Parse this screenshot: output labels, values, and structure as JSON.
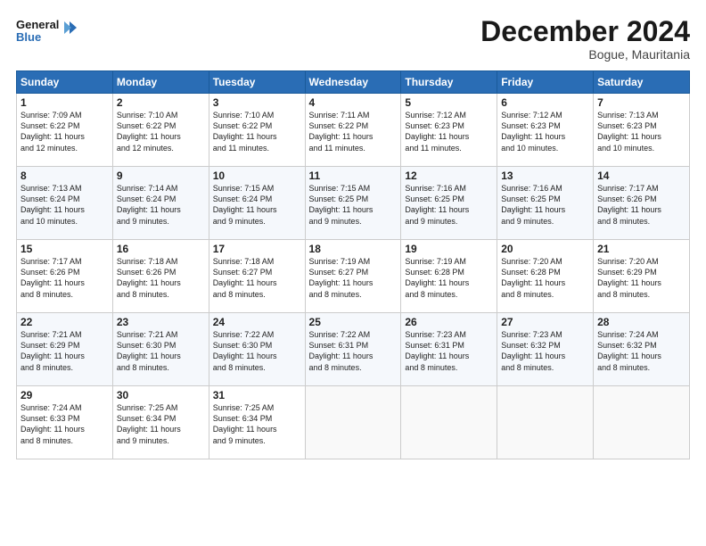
{
  "logo": {
    "line1": "General",
    "line2": "Blue"
  },
  "title": "December 2024",
  "subtitle": "Bogue, Mauritania",
  "days": [
    "Sunday",
    "Monday",
    "Tuesday",
    "Wednesday",
    "Thursday",
    "Friday",
    "Saturday"
  ],
  "weeks": [
    [
      {
        "day": "1",
        "info": "Sunrise: 7:09 AM\nSunset: 6:22 PM\nDaylight: 11 hours\nand 12 minutes."
      },
      {
        "day": "2",
        "info": "Sunrise: 7:10 AM\nSunset: 6:22 PM\nDaylight: 11 hours\nand 12 minutes."
      },
      {
        "day": "3",
        "info": "Sunrise: 7:10 AM\nSunset: 6:22 PM\nDaylight: 11 hours\nand 11 minutes."
      },
      {
        "day": "4",
        "info": "Sunrise: 7:11 AM\nSunset: 6:22 PM\nDaylight: 11 hours\nand 11 minutes."
      },
      {
        "day": "5",
        "info": "Sunrise: 7:12 AM\nSunset: 6:23 PM\nDaylight: 11 hours\nand 11 minutes."
      },
      {
        "day": "6",
        "info": "Sunrise: 7:12 AM\nSunset: 6:23 PM\nDaylight: 11 hours\nand 10 minutes."
      },
      {
        "day": "7",
        "info": "Sunrise: 7:13 AM\nSunset: 6:23 PM\nDaylight: 11 hours\nand 10 minutes."
      }
    ],
    [
      {
        "day": "8",
        "info": "Sunrise: 7:13 AM\nSunset: 6:24 PM\nDaylight: 11 hours\nand 10 minutes."
      },
      {
        "day": "9",
        "info": "Sunrise: 7:14 AM\nSunset: 6:24 PM\nDaylight: 11 hours\nand 9 minutes."
      },
      {
        "day": "10",
        "info": "Sunrise: 7:15 AM\nSunset: 6:24 PM\nDaylight: 11 hours\nand 9 minutes."
      },
      {
        "day": "11",
        "info": "Sunrise: 7:15 AM\nSunset: 6:25 PM\nDaylight: 11 hours\nand 9 minutes."
      },
      {
        "day": "12",
        "info": "Sunrise: 7:16 AM\nSunset: 6:25 PM\nDaylight: 11 hours\nand 9 minutes."
      },
      {
        "day": "13",
        "info": "Sunrise: 7:16 AM\nSunset: 6:25 PM\nDaylight: 11 hours\nand 9 minutes."
      },
      {
        "day": "14",
        "info": "Sunrise: 7:17 AM\nSunset: 6:26 PM\nDaylight: 11 hours\nand 8 minutes."
      }
    ],
    [
      {
        "day": "15",
        "info": "Sunrise: 7:17 AM\nSunset: 6:26 PM\nDaylight: 11 hours\nand 8 minutes."
      },
      {
        "day": "16",
        "info": "Sunrise: 7:18 AM\nSunset: 6:26 PM\nDaylight: 11 hours\nand 8 minutes."
      },
      {
        "day": "17",
        "info": "Sunrise: 7:18 AM\nSunset: 6:27 PM\nDaylight: 11 hours\nand 8 minutes."
      },
      {
        "day": "18",
        "info": "Sunrise: 7:19 AM\nSunset: 6:27 PM\nDaylight: 11 hours\nand 8 minutes."
      },
      {
        "day": "19",
        "info": "Sunrise: 7:19 AM\nSunset: 6:28 PM\nDaylight: 11 hours\nand 8 minutes."
      },
      {
        "day": "20",
        "info": "Sunrise: 7:20 AM\nSunset: 6:28 PM\nDaylight: 11 hours\nand 8 minutes."
      },
      {
        "day": "21",
        "info": "Sunrise: 7:20 AM\nSunset: 6:29 PM\nDaylight: 11 hours\nand 8 minutes."
      }
    ],
    [
      {
        "day": "22",
        "info": "Sunrise: 7:21 AM\nSunset: 6:29 PM\nDaylight: 11 hours\nand 8 minutes."
      },
      {
        "day": "23",
        "info": "Sunrise: 7:21 AM\nSunset: 6:30 PM\nDaylight: 11 hours\nand 8 minutes."
      },
      {
        "day": "24",
        "info": "Sunrise: 7:22 AM\nSunset: 6:30 PM\nDaylight: 11 hours\nand 8 minutes."
      },
      {
        "day": "25",
        "info": "Sunrise: 7:22 AM\nSunset: 6:31 PM\nDaylight: 11 hours\nand 8 minutes."
      },
      {
        "day": "26",
        "info": "Sunrise: 7:23 AM\nSunset: 6:31 PM\nDaylight: 11 hours\nand 8 minutes."
      },
      {
        "day": "27",
        "info": "Sunrise: 7:23 AM\nSunset: 6:32 PM\nDaylight: 11 hours\nand 8 minutes."
      },
      {
        "day": "28",
        "info": "Sunrise: 7:24 AM\nSunset: 6:32 PM\nDaylight: 11 hours\nand 8 minutes."
      }
    ],
    [
      {
        "day": "29",
        "info": "Sunrise: 7:24 AM\nSunset: 6:33 PM\nDaylight: 11 hours\nand 8 minutes."
      },
      {
        "day": "30",
        "info": "Sunrise: 7:25 AM\nSunset: 6:34 PM\nDaylight: 11 hours\nand 9 minutes."
      },
      {
        "day": "31",
        "info": "Sunrise: 7:25 AM\nSunset: 6:34 PM\nDaylight: 11 hours\nand 9 minutes."
      },
      {
        "day": "",
        "info": ""
      },
      {
        "day": "",
        "info": ""
      },
      {
        "day": "",
        "info": ""
      },
      {
        "day": "",
        "info": ""
      }
    ]
  ]
}
